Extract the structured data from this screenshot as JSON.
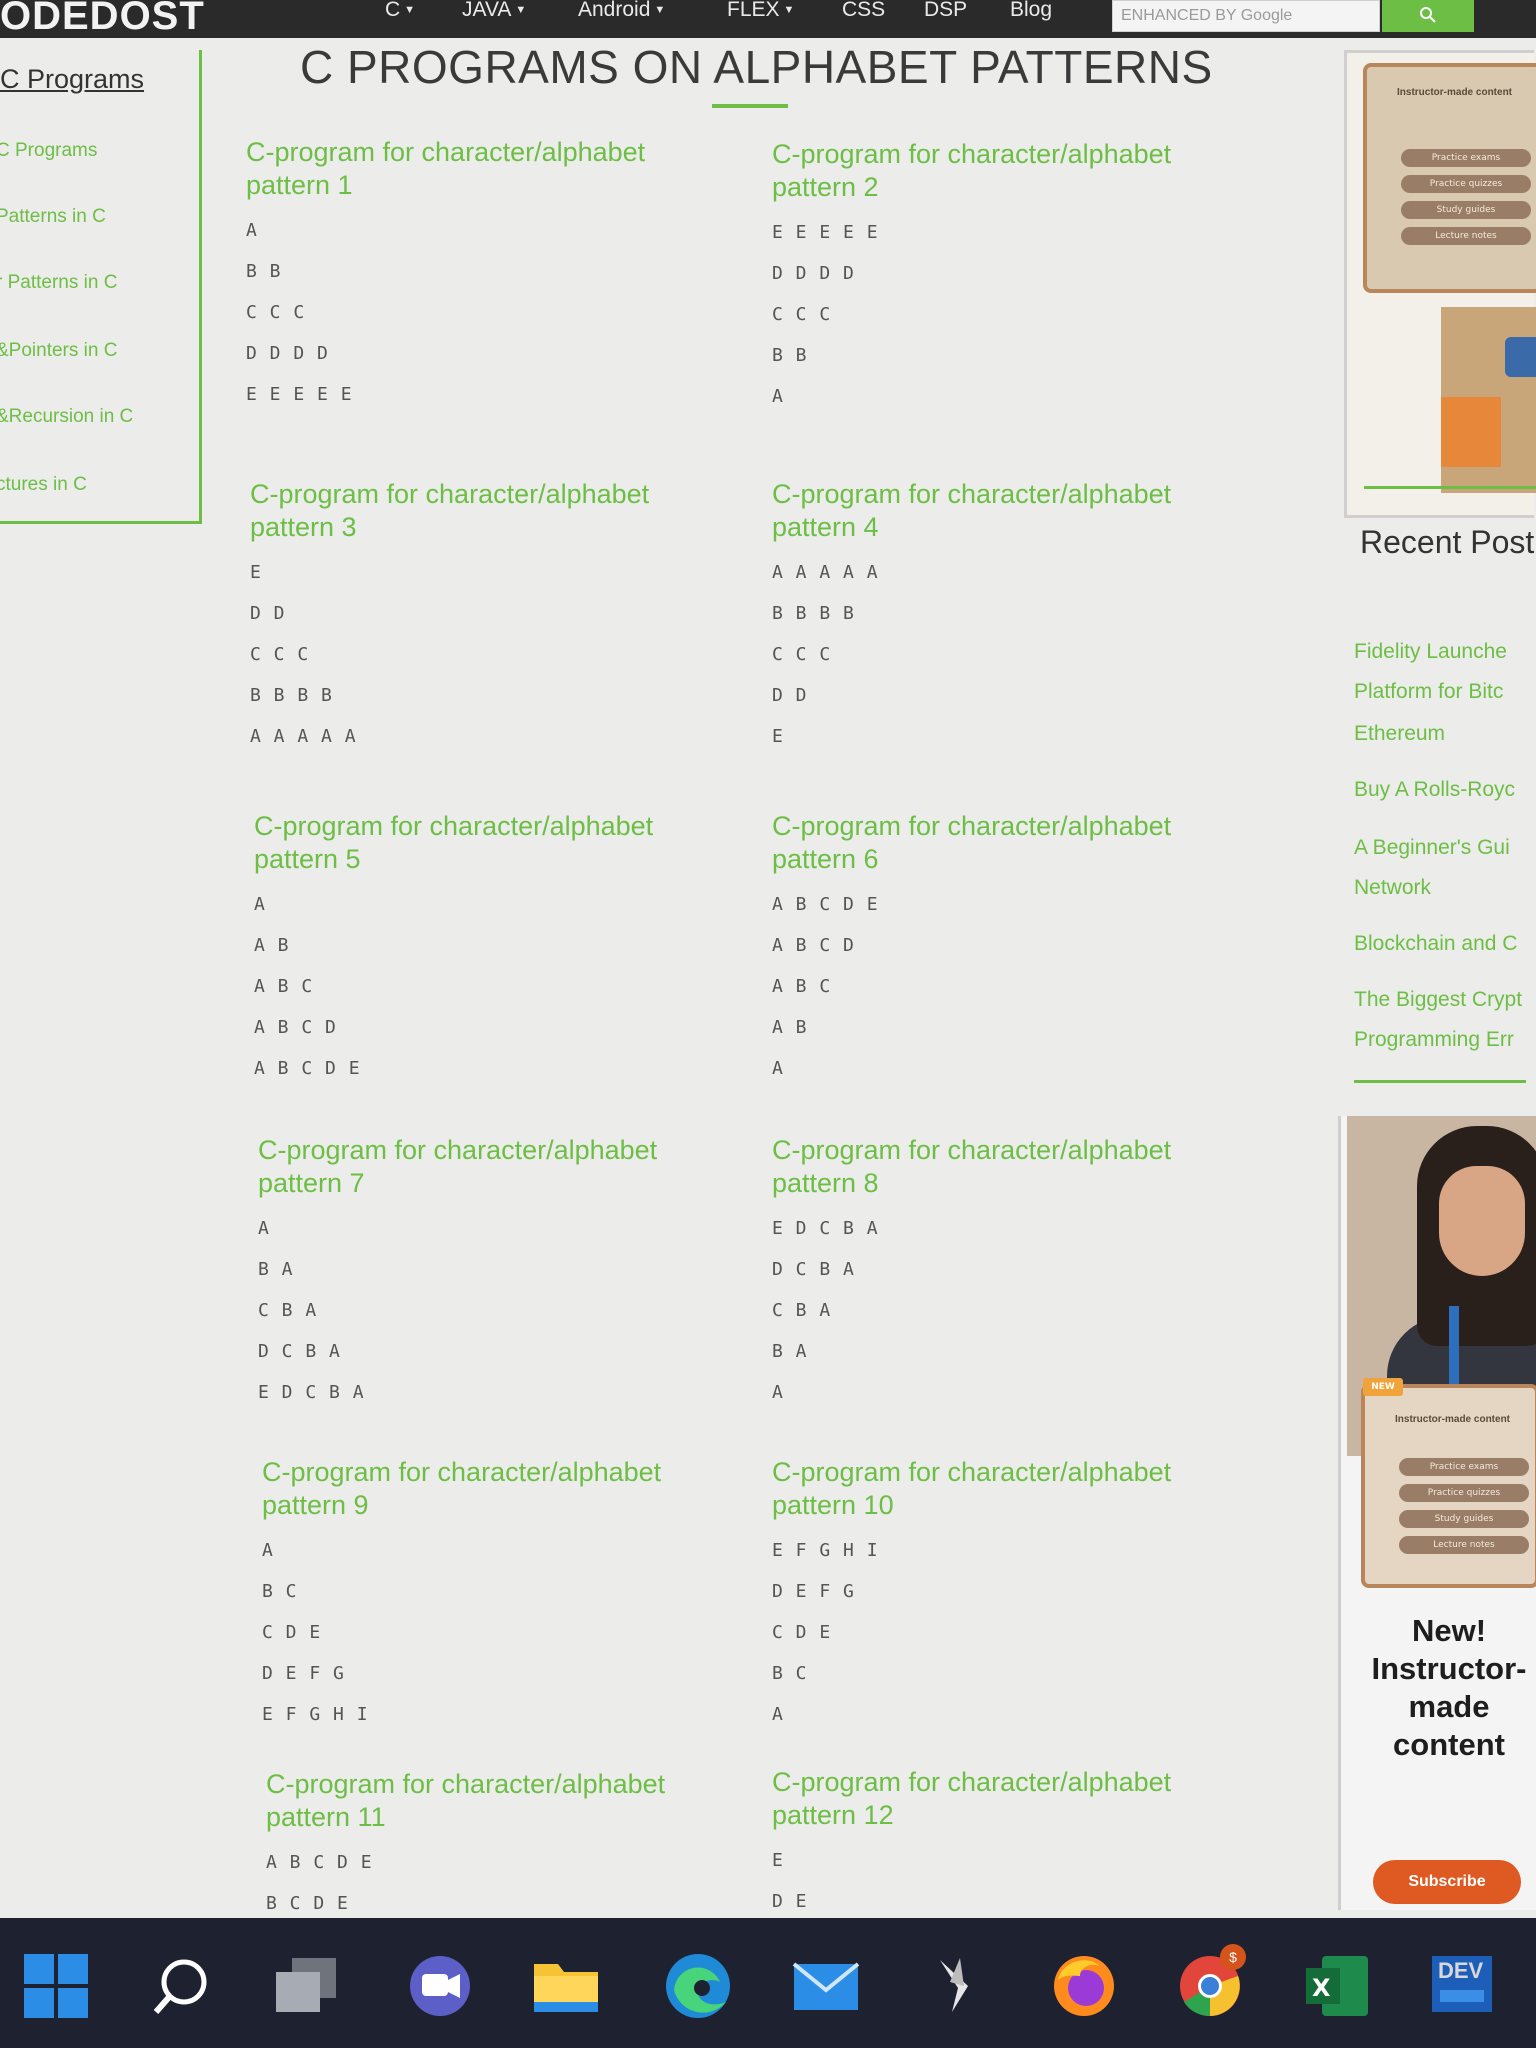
{
  "site": {
    "logo": "ODEDOST"
  },
  "nav": {
    "items": [
      {
        "label": "C",
        "has_dropdown": true
      },
      {
        "label": "JAVA",
        "has_dropdown": true
      },
      {
        "label": "Android",
        "has_dropdown": true
      },
      {
        "label": "FLEX",
        "has_dropdown": true
      },
      {
        "label": "CSS",
        "has_dropdown": false
      },
      {
        "label": "DSP",
        "has_dropdown": false
      },
      {
        "label": "Blog",
        "has_dropdown": false
      }
    ]
  },
  "search": {
    "placeholder": "ENHANCED BY Google",
    "value": ""
  },
  "page": {
    "title": "C PROGRAMS ON ALPHABET PATTERNS"
  },
  "sidebar": {
    "heading": "C Programs",
    "links": [
      "C Programs",
      "Patterns in C",
      "r Patterns in C",
      "&Pointers in C",
      "&Recursion in C",
      "ctures in C"
    ]
  },
  "patterns": [
    {
      "title": "C-program for character/alphabet pattern 1",
      "lines": [
        "A",
        "B B",
        "C C C",
        "D D D D",
        "E E E E E"
      ]
    },
    {
      "title": "C-program for character/alphabet pattern 2",
      "lines": [
        "E E E E E",
        "D D D D",
        "C C C",
        "B B",
        "A"
      ]
    },
    {
      "title": "C-program for character/alphabet pattern 3",
      "lines": [
        "E",
        "D D",
        "C C C",
        "B B B B",
        "A A A A A"
      ]
    },
    {
      "title": "C-program for character/alphabet pattern 4",
      "lines": [
        "A A A A A",
        "B B B B",
        "C C C",
        "D D",
        "E"
      ]
    },
    {
      "title": "C-program for character/alphabet pattern 5",
      "lines": [
        "A",
        "A B",
        "A B C",
        "A B C D",
        "A B C D E"
      ]
    },
    {
      "title": "C-program for character/alphabet pattern 6",
      "lines": [
        "A B C D E",
        "A B C D",
        "A B C",
        "A B",
        "A"
      ]
    },
    {
      "title": "C-program for character/alphabet pattern 7",
      "lines": [
        "A",
        "B A",
        "C B A",
        "D C B A",
        "E D C B A"
      ]
    },
    {
      "title": "C-program for character/alphabet pattern 8",
      "lines": [
        "E D C B A",
        "D C B A",
        "C B A",
        "B A",
        "A"
      ]
    },
    {
      "title": "C-program for character/alphabet pattern 9",
      "lines": [
        "A",
        "B C",
        "C D E",
        "D E F G",
        "E F G H I"
      ]
    },
    {
      "title": "C-program for character/alphabet pattern 10",
      "lines": [
        "E F G H I",
        "D E F G",
        "C D E",
        "B C",
        "A"
      ]
    },
    {
      "title": "C-program for character/alphabet pattern 11",
      "lines": [
        "A B C D E",
        "B C D E"
      ]
    },
    {
      "title": "C-program for character/alphabet pattern 12",
      "lines": [
        "E",
        "D E"
      ]
    }
  ],
  "right_sidebar": {
    "ad_top_lines": [
      "Instructor-made content",
      "Practice exams",
      "Practice quizzes",
      "Study guides",
      "Lecture notes"
    ],
    "recent_heading": "Recent Post",
    "recent_posts": [
      "Fidelity Launche",
      "Platform for Bitc",
      "Ethereum",
      "Buy A Rolls-Royc",
      "A Beginner's Gui",
      "Network",
      "Blockchain and C",
      "The Biggest Crypt",
      "Programming Err"
    ],
    "ad_bottom": {
      "badge": "NEW",
      "lines": [
        "Instructor-made content",
        "Practice exams",
        "Practice quizzes",
        "Study guides",
        "Lecture notes"
      ],
      "headline": "New!\nInstructor-\nmade\ncontent",
      "button": "Subscribe"
    }
  },
  "taskbar": {
    "apps": [
      "windows-start",
      "search",
      "task-view",
      "teams",
      "file-explorer",
      "edge",
      "mail",
      "pen-app",
      "firefox",
      "chrome",
      "excel",
      "dev"
    ],
    "chrome_badge": "$",
    "dev_label": "DEV"
  }
}
